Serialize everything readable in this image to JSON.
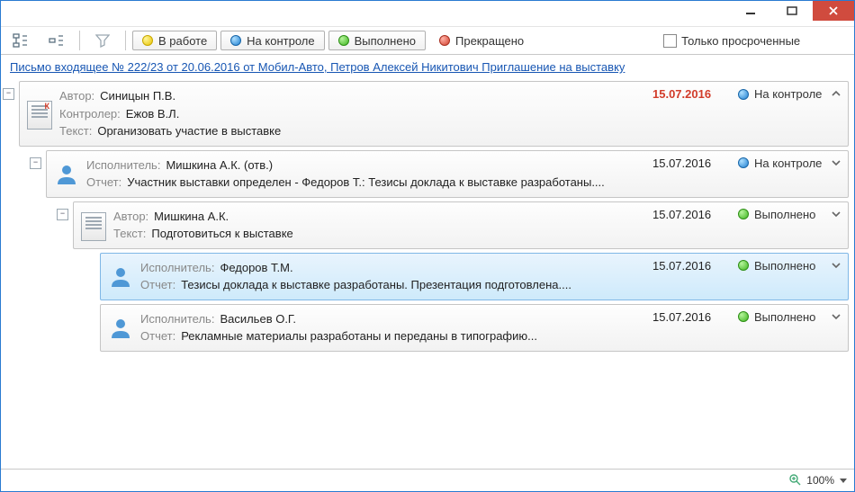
{
  "toolbar": {
    "filters": [
      {
        "label": "В работе",
        "color": "yellow"
      },
      {
        "label": "На контроле",
        "color": "blue"
      },
      {
        "label": "Выполнено",
        "color": "green"
      },
      {
        "label": "Прекращено",
        "color": "red"
      }
    ],
    "only_overdue_label": "Только просроченные"
  },
  "link": {
    "text": "Письмо входящее № 222/23 от 20.06.2016 от Мобил-Авто, Петров Алексей Никитович Приглашение на выставку"
  },
  "labels": {
    "author": "Автор:",
    "controller": "Контролер:",
    "text": "Текст:",
    "executor": "Исполнитель:",
    "report": "Отчет:"
  },
  "statuses": {
    "in_control": "На контроле",
    "done": "Выполнено"
  },
  "items": {
    "task1": {
      "author": "Синицын П.В.",
      "controller": "Ежов В.Л.",
      "text": "Организовать участие в выставке",
      "date": "15.07.2016",
      "status": "На контроле"
    },
    "exec1": {
      "executor": "Мишкина А.К. (отв.)",
      "report": "Участник выставки определен - Федоров Т.: Тезисы доклада к выставке разработаны....",
      "date": "15.07.2016",
      "status": "На контроле"
    },
    "task2": {
      "author": "Мишкина А.К.",
      "text": "Подготовиться к выставке",
      "date": "15.07.2016",
      "status": "Выполнено"
    },
    "exec2": {
      "executor": "Федоров Т.М.",
      "report": "Тезисы доклада к выставке разработаны. Презентация подготовлена....",
      "date": "15.07.2016",
      "status": "Выполнено"
    },
    "exec3": {
      "executor": "Васильев О.Г.",
      "report": "Рекламные материалы разработаны и переданы в типографию...",
      "date": "15.07.2016",
      "status": "Выполнено"
    }
  },
  "statusbar": {
    "zoom": "100%"
  }
}
